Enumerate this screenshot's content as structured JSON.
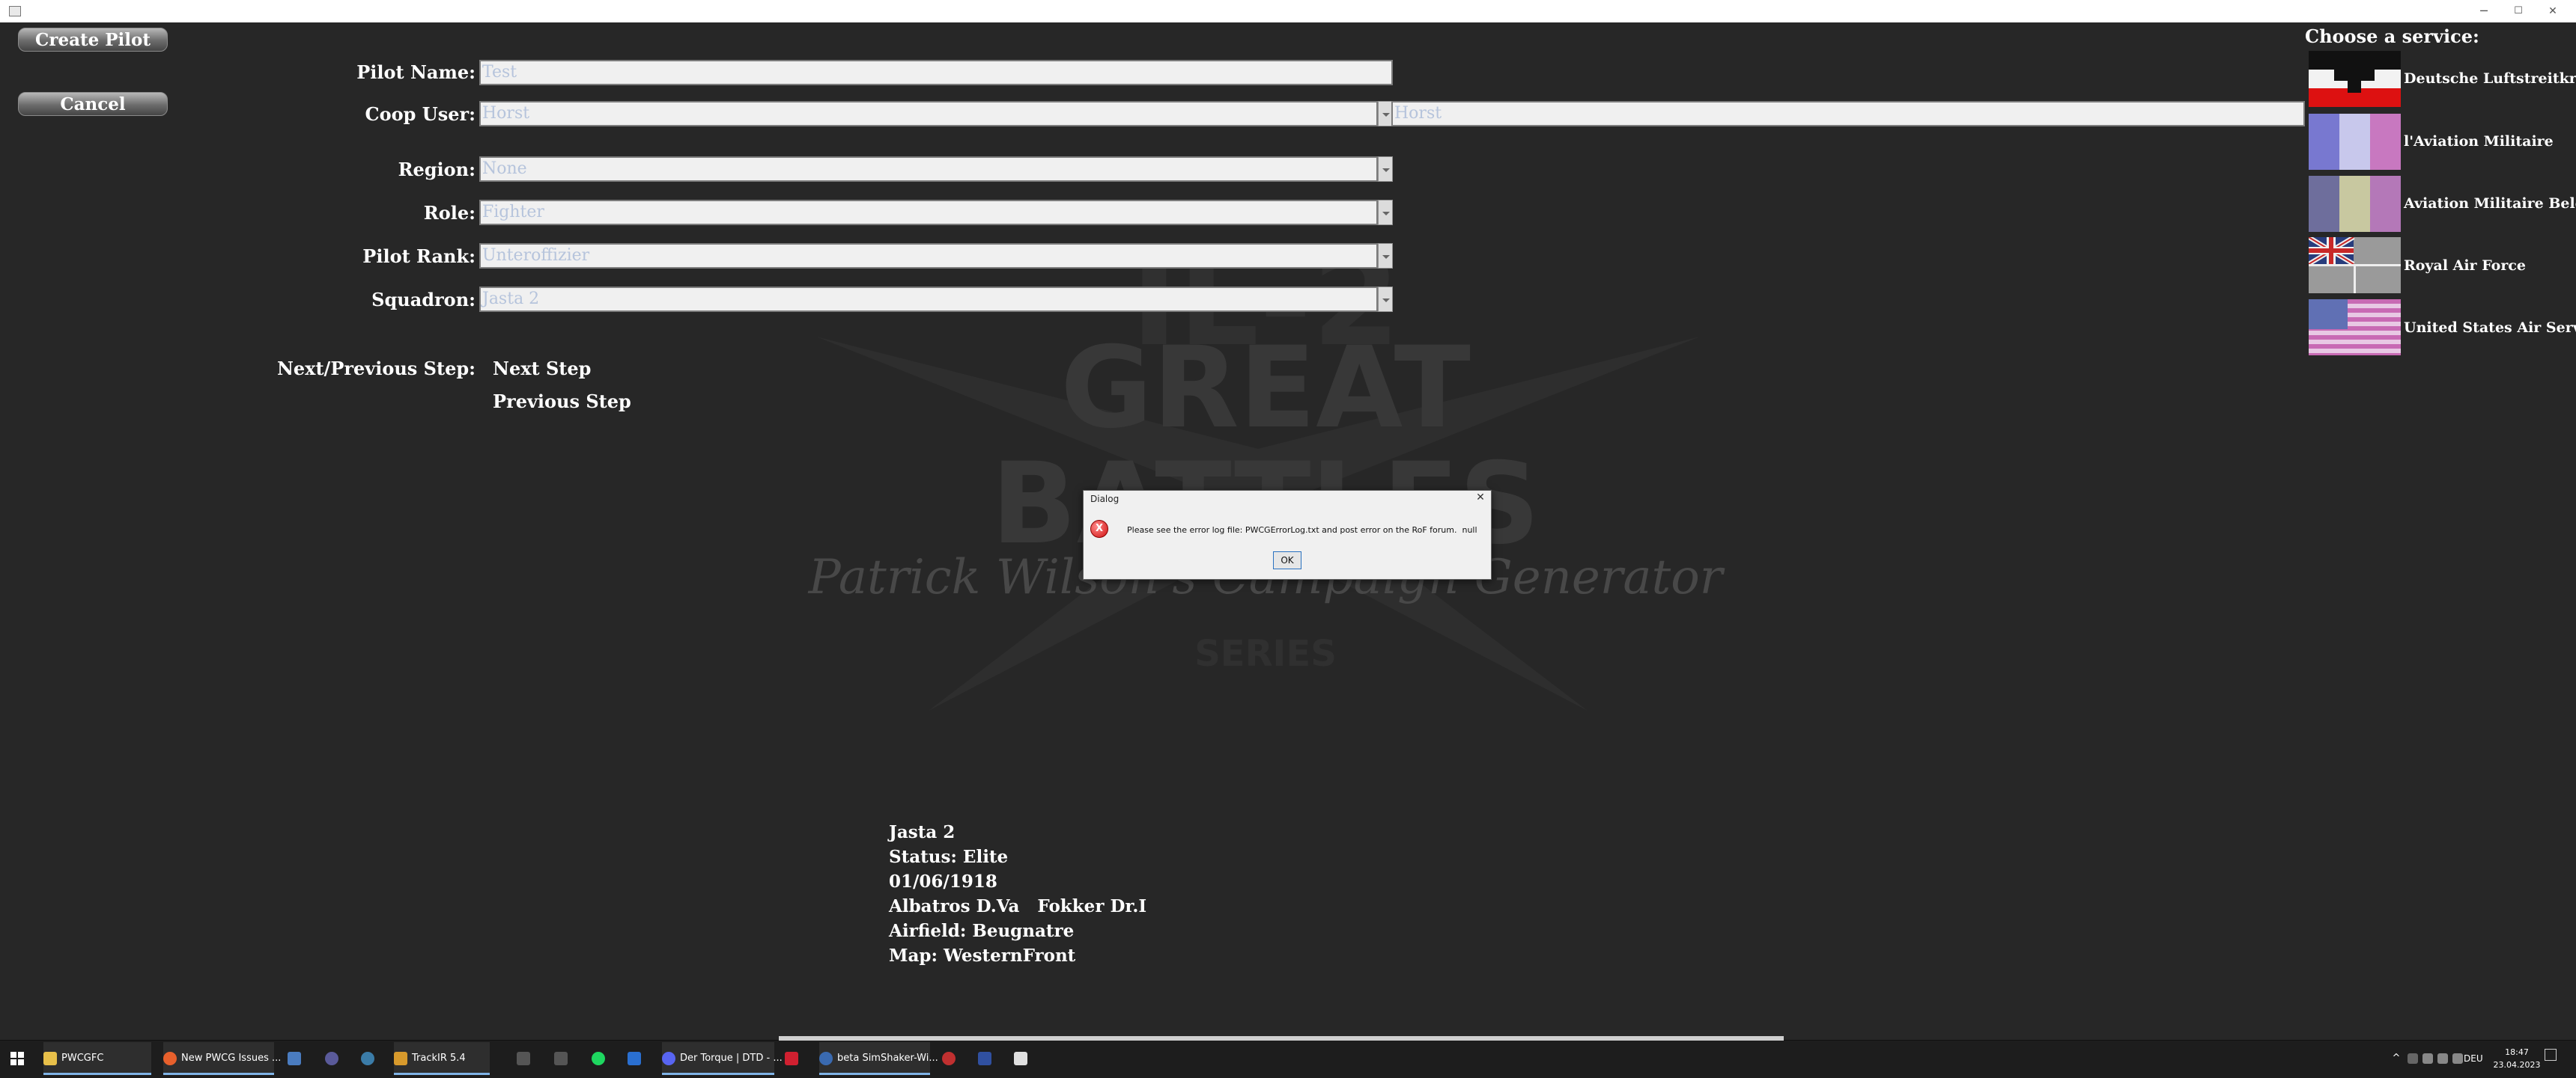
{
  "window": {
    "minimize": "─",
    "maximize": "☐",
    "close": "✕"
  },
  "sidebar": {
    "create_pilot": "Create Pilot",
    "cancel": "Cancel"
  },
  "form": {
    "pilot_name": {
      "label": "Pilot Name:",
      "value": "Test"
    },
    "coop_user": {
      "label": "Coop User:",
      "value": "Horst",
      "text": "Horst"
    },
    "region": {
      "label": "Region:",
      "value": "None"
    },
    "role": {
      "label": "Role:",
      "value": "Fighter"
    },
    "pilot_rank": {
      "label": "Pilot Rank:",
      "value": "Unteroffizier"
    },
    "squadron": {
      "label": "Squadron:",
      "value": "Jasta 2"
    },
    "step": {
      "label": "Next/Previous Step:",
      "next": "Next Step",
      "previous": "Previous Step"
    }
  },
  "background_logo": {
    "line1": "IL-2",
    "line2": "GREAT",
    "line3": "BATTLES",
    "tagline": "Patrick Wilson's Campaign Generator",
    "series": "SERIES"
  },
  "services": {
    "heading": "Choose a service:",
    "items": [
      {
        "name": "Deutsche Luftstreitkräfte",
        "flag": "german-empire-flag-icon"
      },
      {
        "name": "l'Aviation Militaire",
        "flag": "french-flag-icon"
      },
      {
        "name": "Aviation Militaire Belge",
        "flag": "belgian-flag-icon"
      },
      {
        "name": "Royal Air Force",
        "flag": "british-flag-icon"
      },
      {
        "name": "United States Air Service",
        "flag": "us-flag-icon"
      }
    ]
  },
  "info": {
    "squadron": "Jasta 2",
    "status": "Status: Elite",
    "date": "01/06/1918",
    "aircraft": "Albatros D.Va   Fokker Dr.I",
    "airfield": "Airfield: Beugnatre",
    "map": "Map: WesternFront"
  },
  "dialog": {
    "title": "Dialog",
    "close": "✕",
    "message": "Please see the error log file: PWCGErrorLog.txt and post error on the RoF forum.  null",
    "ok": "OK"
  },
  "taskbar": {
    "items": [
      {
        "label": "PWCGFC"
      },
      {
        "label": "New PWCG Issues ..."
      },
      {
        "label": "TrackIR 5.4"
      },
      {
        "label": "Der Torque | DTD - ..."
      },
      {
        "label": "beta SimShaker-Wi..."
      }
    ],
    "language": "DEU",
    "time": "18:47",
    "date": "23.04.2023"
  },
  "colors": {
    "background": "#272727",
    "dialog": "#f0f0f0",
    "field": "#f0f0f0",
    "field_text": "#b6c4dc",
    "error": "#e81123",
    "accent": "#7fb3e6"
  }
}
